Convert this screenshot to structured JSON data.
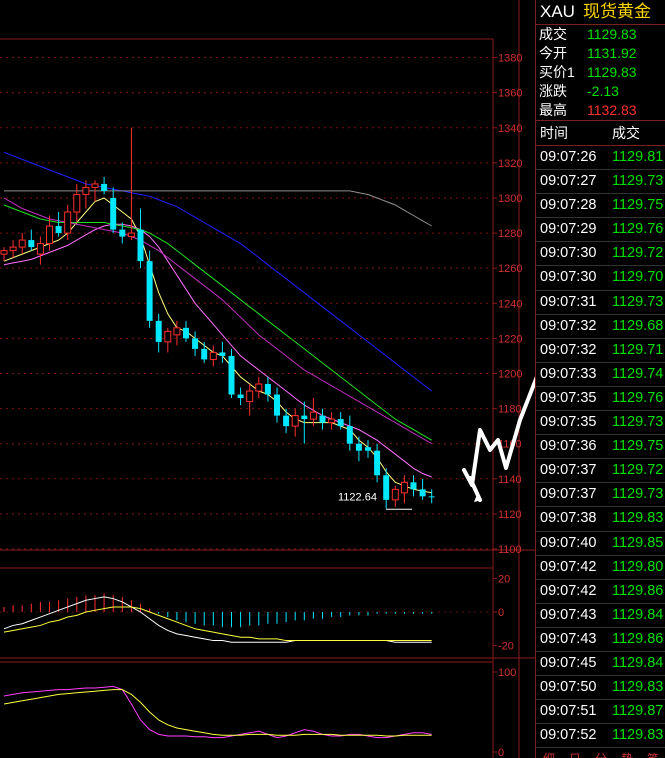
{
  "header": {
    "symbol": "XAU",
    "name": "现货黄金"
  },
  "quote": [
    {
      "label": "成交",
      "value": "1129.83",
      "color": "#00e000"
    },
    {
      "label": "今开",
      "value": "1131.92",
      "color": "#00e000"
    },
    {
      "label": "买价1",
      "value": "1129.83",
      "color": "#00e000"
    },
    {
      "label": "涨跌",
      "value": "-2.13",
      "color": "#00e000"
    },
    {
      "label": "最高",
      "value": "1132.83",
      "color": "#ff3030"
    }
  ],
  "ticks_header": {
    "time": "时间",
    "price": "成交"
  },
  "ticks": [
    {
      "time": "09:07:26",
      "price": "1129.81"
    },
    {
      "time": "09:07:27",
      "price": "1129.73"
    },
    {
      "time": "09:07:28",
      "price": "1129.75"
    },
    {
      "time": "09:07:29",
      "price": "1129.76"
    },
    {
      "time": "09:07:30",
      "price": "1129.72"
    },
    {
      "time": "09:07:30",
      "price": "1129.70"
    },
    {
      "time": "09:07:31",
      "price": "1129.73"
    },
    {
      "time": "09:07:32",
      "price": "1129.68"
    },
    {
      "time": "09:07:32",
      "price": "1129.71"
    },
    {
      "time": "09:07:33",
      "price": "1129.74"
    },
    {
      "time": "09:07:35",
      "price": "1129.76"
    },
    {
      "time": "09:07:35",
      "price": "1129.73"
    },
    {
      "time": "09:07:36",
      "price": "1129.75"
    },
    {
      "time": "09:07:37",
      "price": "1129.72"
    },
    {
      "time": "09:07:37",
      "price": "1129.73"
    },
    {
      "time": "09:07:38",
      "price": "1129.83"
    },
    {
      "time": "09:07:40",
      "price": "1129.85"
    },
    {
      "time": "09:07:42",
      "price": "1129.80"
    },
    {
      "time": "09:07:42",
      "price": "1129.86"
    },
    {
      "time": "09:07:43",
      "price": "1129.84"
    },
    {
      "time": "09:07:43",
      "price": "1129.86"
    },
    {
      "time": "09:07:45",
      "price": "1129.84"
    },
    {
      "time": "09:07:50",
      "price": "1129.83"
    },
    {
      "time": "09:07:51",
      "price": "1129.87"
    },
    {
      "time": "09:07:52",
      "price": "1129.83"
    }
  ],
  "footer_tabs": [
    "细",
    "日",
    "分",
    "势",
    "笔"
  ],
  "chart_data": {
    "type": "candlestick",
    "price_axis": {
      "ticks": [
        1380,
        1360,
        1340,
        1320,
        1300,
        1280,
        1260,
        1240,
        1220,
        1200,
        1180,
        1160,
        1140,
        1120,
        1100
      ],
      "range": [
        1100,
        1390
      ]
    },
    "low_annotation": {
      "value": 1122.64,
      "text": "1122.64"
    },
    "candles": [
      {
        "o": 1268,
        "h": 1272,
        "l": 1264,
        "c": 1270
      },
      {
        "o": 1270,
        "h": 1276,
        "l": 1266,
        "c": 1272
      },
      {
        "o": 1272,
        "h": 1280,
        "l": 1268,
        "c": 1276
      },
      {
        "o": 1276,
        "h": 1282,
        "l": 1270,
        "c": 1272
      },
      {
        "o": 1268,
        "h": 1278,
        "l": 1262,
        "c": 1274
      },
      {
        "o": 1274,
        "h": 1290,
        "l": 1270,
        "c": 1284
      },
      {
        "o": 1284,
        "h": 1292,
        "l": 1278,
        "c": 1280
      },
      {
        "o": 1280,
        "h": 1296,
        "l": 1276,
        "c": 1292
      },
      {
        "o": 1292,
        "h": 1308,
        "l": 1286,
        "c": 1302
      },
      {
        "o": 1302,
        "h": 1310,
        "l": 1294,
        "c": 1306
      },
      {
        "o": 1306,
        "h": 1310,
        "l": 1298,
        "c": 1308
      },
      {
        "o": 1308,
        "h": 1312,
        "l": 1302,
        "c": 1304
      },
      {
        "o": 1300,
        "h": 1306,
        "l": 1280,
        "c": 1282
      },
      {
        "o": 1282,
        "h": 1286,
        "l": 1274,
        "c": 1278
      },
      {
        "o": 1278,
        "h": 1340,
        "l": 1276,
        "c": 1280
      },
      {
        "o": 1282,
        "h": 1294,
        "l": 1260,
        "c": 1264
      },
      {
        "o": 1264,
        "h": 1270,
        "l": 1226,
        "c": 1230
      },
      {
        "o": 1230,
        "h": 1234,
        "l": 1212,
        "c": 1218
      },
      {
        "o": 1218,
        "h": 1226,
        "l": 1212,
        "c": 1224
      },
      {
        "o": 1222,
        "h": 1230,
        "l": 1216,
        "c": 1226
      },
      {
        "o": 1226,
        "h": 1230,
        "l": 1218,
        "c": 1220
      },
      {
        "o": 1220,
        "h": 1224,
        "l": 1210,
        "c": 1214
      },
      {
        "o": 1214,
        "h": 1218,
        "l": 1206,
        "c": 1208
      },
      {
        "o": 1208,
        "h": 1216,
        "l": 1204,
        "c": 1212
      },
      {
        "o": 1212,
        "h": 1218,
        "l": 1206,
        "c": 1210
      },
      {
        "o": 1210,
        "h": 1214,
        "l": 1186,
        "c": 1188
      },
      {
        "o": 1188,
        "h": 1192,
        "l": 1182,
        "c": 1186
      },
      {
        "o": 1184,
        "h": 1194,
        "l": 1176,
        "c": 1190
      },
      {
        "o": 1190,
        "h": 1198,
        "l": 1186,
        "c": 1194
      },
      {
        "o": 1194,
        "h": 1198,
        "l": 1184,
        "c": 1188
      },
      {
        "o": 1188,
        "h": 1192,
        "l": 1172,
        "c": 1176
      },
      {
        "o": 1176,
        "h": 1180,
        "l": 1166,
        "c": 1170
      },
      {
        "o": 1170,
        "h": 1180,
        "l": 1164,
        "c": 1176
      },
      {
        "o": 1176,
        "h": 1184,
        "l": 1160,
        "c": 1174
      },
      {
        "o": 1174,
        "h": 1186,
        "l": 1170,
        "c": 1178
      },
      {
        "o": 1176,
        "h": 1180,
        "l": 1168,
        "c": 1172
      },
      {
        "o": 1172,
        "h": 1178,
        "l": 1168,
        "c": 1174
      },
      {
        "o": 1174,
        "h": 1178,
        "l": 1168,
        "c": 1170
      },
      {
        "o": 1170,
        "h": 1176,
        "l": 1156,
        "c": 1160
      },
      {
        "o": 1160,
        "h": 1164,
        "l": 1150,
        "c": 1156
      },
      {
        "o": 1158,
        "h": 1162,
        "l": 1152,
        "c": 1156
      },
      {
        "o": 1156,
        "h": 1160,
        "l": 1138,
        "c": 1142
      },
      {
        "o": 1142,
        "h": 1146,
        "l": 1123,
        "c": 1128
      },
      {
        "o": 1128,
        "h": 1136,
        "l": 1124,
        "c": 1134
      },
      {
        "o": 1132,
        "h": 1142,
        "l": 1126,
        "c": 1138
      },
      {
        "o": 1138,
        "h": 1142,
        "l": 1130,
        "c": 1134
      },
      {
        "o": 1134,
        "h": 1140,
        "l": 1128,
        "c": 1130
      },
      {
        "o": 1130,
        "h": 1134,
        "l": 1126,
        "c": 1129.83
      }
    ],
    "ma_lines": [
      {
        "color": "#ffff80",
        "values": [
          1264,
          1266,
          1268,
          1270,
          1272,
          1274,
          1276,
          1280,
          1286,
          1292,
          1298,
          1300,
          1296,
          1292,
          1288,
          1278,
          1262,
          1246,
          1234,
          1226,
          1224,
          1220,
          1216,
          1212,
          1210,
          1204,
          1198,
          1194,
          1190,
          1188,
          1184,
          1178,
          1174,
          1172,
          1172,
          1172,
          1172,
          1170,
          1168,
          1162,
          1158,
          1152,
          1144,
          1138,
          1136,
          1134,
          1133,
          1132
        ]
      },
      {
        "color": "#ff70ff",
        "values": [
          1262,
          1263,
          1264,
          1265,
          1267,
          1269,
          1271,
          1273,
          1276,
          1279,
          1282,
          1284,
          1285,
          1285,
          1284,
          1282,
          1278,
          1272,
          1264,
          1256,
          1248,
          1240,
          1234,
          1228,
          1222,
          1216,
          1210,
          1206,
          1202,
          1198,
          1194,
          1190,
          1186,
          1182,
          1179,
          1176,
          1174,
          1172,
          1170,
          1168,
          1165,
          1162,
          1158,
          1154,
          1150,
          1146,
          1143,
          1141
        ]
      },
      {
        "color": "#20e020",
        "values": [
          1296,
          1294,
          1292,
          1290,
          1288,
          1287,
          1286,
          1286,
          1286,
          1286,
          1286,
          1286,
          1285,
          1284,
          1283,
          1282,
          1280,
          1277,
          1274,
          1270,
          1266,
          1262,
          1258,
          1254,
          1250,
          1246,
          1242,
          1238,
          1234,
          1230,
          1226,
          1222,
          1218,
          1214,
          1210,
          1206,
          1202,
          1198,
          1194,
          1190,
          1186,
          1182,
          1178,
          1174,
          1171,
          1168,
          1165,
          1162
        ]
      },
      {
        "color": "#c030c0",
        "values": [
          1300,
          1297,
          1294,
          1292,
          1290,
          1288,
          1287,
          1286,
          1285,
          1284,
          1283,
          1282,
          1281,
          1280,
          1278,
          1276,
          1273,
          1270,
          1266,
          1262,
          1258,
          1254,
          1250,
          1246,
          1242,
          1237,
          1232,
          1227,
          1222,
          1218,
          1214,
          1210,
          1206,
          1202,
          1199,
          1196,
          1193,
          1190,
          1187,
          1184,
          1181,
          1178,
          1175,
          1172,
          1169,
          1166,
          1163,
          1160
        ]
      },
      {
        "color": "#2020ff",
        "values": [
          1326,
          1324,
          1322,
          1320,
          1318,
          1316,
          1314,
          1312,
          1310,
          1308,
          1307,
          1306,
          1305,
          1304,
          1303,
          1302,
          1301,
          1299,
          1297,
          1295,
          1292,
          1289,
          1286,
          1283,
          1280,
          1277,
          1274,
          1270,
          1266,
          1262,
          1258,
          1254,
          1250,
          1246,
          1242,
          1238,
          1234,
          1230,
          1226,
          1222,
          1218,
          1214,
          1210,
          1206,
          1202,
          1198,
          1194,
          1190
        ]
      },
      {
        "color": "#909090",
        "values": [
          1304,
          1304,
          1304,
          1304,
          1304,
          1304,
          1304,
          1304,
          1304,
          1304,
          1304,
          1304,
          1304,
          1304,
          1304,
          1304,
          1304,
          1304,
          1304,
          1304,
          1304,
          1304,
          1304,
          1304,
          1304,
          1304,
          1304,
          1304,
          1304,
          1304,
          1304,
          1304,
          1304,
          1304,
          1304,
          1304,
          1304,
          1304,
          1304,
          1303,
          1302,
          1300,
          1298,
          1296,
          1293,
          1290,
          1287,
          1284
        ]
      }
    ],
    "macd": {
      "axis_ticks": [
        20,
        0,
        -20
      ],
      "range": [
        -25,
        25
      ],
      "hist": [
        3,
        4,
        4,
        5,
        6,
        6,
        7,
        8,
        9,
        10,
        10,
        11,
        10,
        9,
        7,
        5,
        2,
        -1,
        -3,
        -5,
        -6,
        -7,
        -8,
        -8,
        -9,
        -9,
        -9,
        -8,
        -8,
        -7,
        -7,
        -6,
        -5,
        -5,
        -4,
        -4,
        -3,
        -3,
        -2,
        -2,
        -2,
        -1,
        -1,
        -1,
        -1,
        -1,
        -1,
        -1
      ],
      "dif": [
        -10,
        -8,
        -7,
        -5,
        -3,
        -1,
        1,
        3,
        5,
        7,
        8,
        9,
        8,
        6,
        3,
        0,
        -4,
        -8,
        -11,
        -13,
        -14,
        -15,
        -16,
        -17,
        -17,
        -18,
        -18,
        -18,
        -18,
        -18,
        -18,
        -18,
        -17,
        -17,
        -17,
        -17,
        -17,
        -17,
        -17,
        -17,
        -17,
        -17,
        -17,
        -18,
        -18,
        -18,
        -18,
        -18
      ],
      "dea": [
        -12,
        -11,
        -10,
        -9,
        -8,
        -6,
        -5,
        -3,
        -2,
        0,
        1,
        2,
        3,
        3,
        3,
        2,
        0,
        -2,
        -4,
        -6,
        -8,
        -10,
        -11,
        -12,
        -13,
        -14,
        -15,
        -15,
        -16,
        -16,
        -16,
        -17,
        -17,
        -17,
        -17,
        -17,
        -17,
        -17,
        -17,
        -17,
        -17,
        -17,
        -17,
        -17,
        -17,
        -17,
        -17,
        -17
      ]
    },
    "kdj": {
      "axis_ticks": [
        100,
        0
      ],
      "range": [
        -5,
        110
      ],
      "k": [
        70,
        72,
        74,
        75,
        76,
        77,
        78,
        78,
        79,
        80,
        80,
        81,
        82,
        78,
        60,
        40,
        28,
        22,
        20,
        20,
        20,
        19,
        19,
        18,
        18,
        20,
        22,
        24,
        26,
        22,
        18,
        20,
        24,
        28,
        26,
        22,
        20,
        20,
        22,
        22,
        20,
        18,
        18,
        20,
        22,
        24,
        24,
        22
      ],
      "d": [
        60,
        62,
        64,
        66,
        68,
        70,
        72,
        73,
        74,
        75,
        76,
        77,
        78,
        78,
        72,
        62,
        50,
        40,
        34,
        30,
        28,
        26,
        24,
        22,
        21,
        21,
        21,
        22,
        22,
        22,
        21,
        21,
        21,
        22,
        22,
        22,
        22,
        21,
        21,
        21,
        21,
        21,
        20,
        20,
        21,
        21,
        21,
        21
      ]
    }
  }
}
